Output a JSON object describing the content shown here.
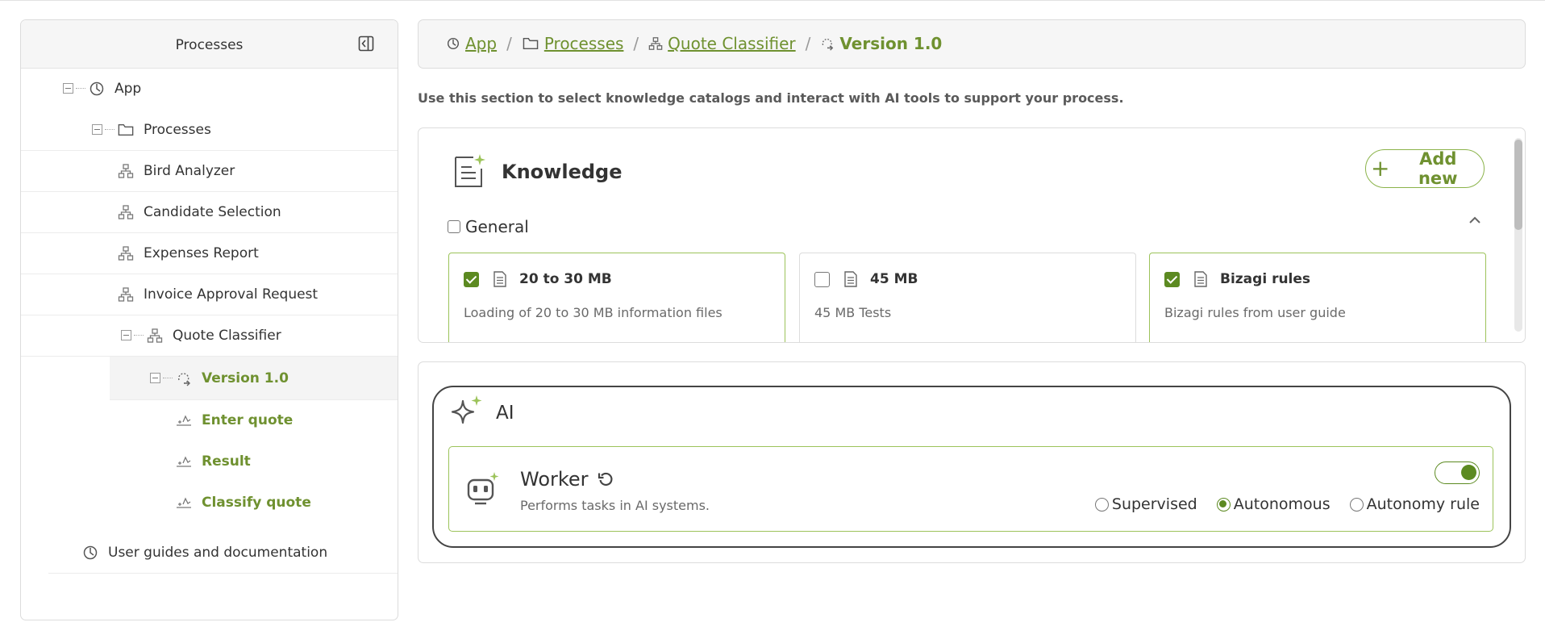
{
  "sidebar": {
    "title": "Processes",
    "tree": [
      {
        "label": "App",
        "icon": "app-icon"
      },
      {
        "label": "Processes",
        "icon": "folder-icon"
      },
      {
        "label": "Bird Analyzer",
        "icon": "process-icon"
      },
      {
        "label": "Candidate Selection",
        "icon": "process-icon"
      },
      {
        "label": "Expenses Report",
        "icon": "process-icon"
      },
      {
        "label": "Invoice Approval Request",
        "icon": "process-icon"
      },
      {
        "label": "Quote Classifier",
        "icon": "process-icon"
      },
      {
        "label": "Version 1.0",
        "icon": "version-icon"
      },
      {
        "label": "Enter quote",
        "icon": "task-icon"
      },
      {
        "label": "Result",
        "icon": "task-icon"
      },
      {
        "label": "Classify quote",
        "icon": "task-icon"
      },
      {
        "label": "User guides and documentation",
        "icon": "app-icon"
      }
    ]
  },
  "breadcrumb": {
    "items": [
      {
        "label": "App",
        "icon": "app-icon"
      },
      {
        "label": "Processes",
        "icon": "folder-icon"
      },
      {
        "label": "Quote Classifier",
        "icon": "process-icon"
      }
    ],
    "current": {
      "label": "Version 1.0",
      "icon": "version-icon"
    },
    "separator": "/"
  },
  "intro_text": "Use this section to select knowledge catalogs and interact with AI tools to support your process.",
  "knowledge": {
    "title": "Knowledge",
    "add_button": {
      "plus": "+",
      "label": "Add new"
    },
    "group": {
      "label": "General",
      "checked": false,
      "expanded": true
    },
    "cards": [
      {
        "title": "20 to 30 MB",
        "description": "Loading of 20 to 30 MB information files",
        "checked": true
      },
      {
        "title": "45 MB",
        "description": "45 MB Tests",
        "checked": false
      },
      {
        "title": "Bizagi rules",
        "description": "Bizagi rules from user guide",
        "checked": true
      }
    ]
  },
  "ai": {
    "title": "AI",
    "worker": {
      "title": "Worker",
      "description": "Performs tasks in AI systems.",
      "enabled": true,
      "modes": [
        {
          "label": "Supervised",
          "selected": false
        },
        {
          "label": "Autonomous",
          "selected": true
        },
        {
          "label": "Autonomy rule",
          "selected": false
        }
      ]
    }
  },
  "colors": {
    "accent": "#6f9130",
    "accent_dark": "#5c8a21",
    "accent_light": "#9cc35a",
    "border": "#dcdcdc",
    "panel_bg": "#f6f6f6"
  }
}
